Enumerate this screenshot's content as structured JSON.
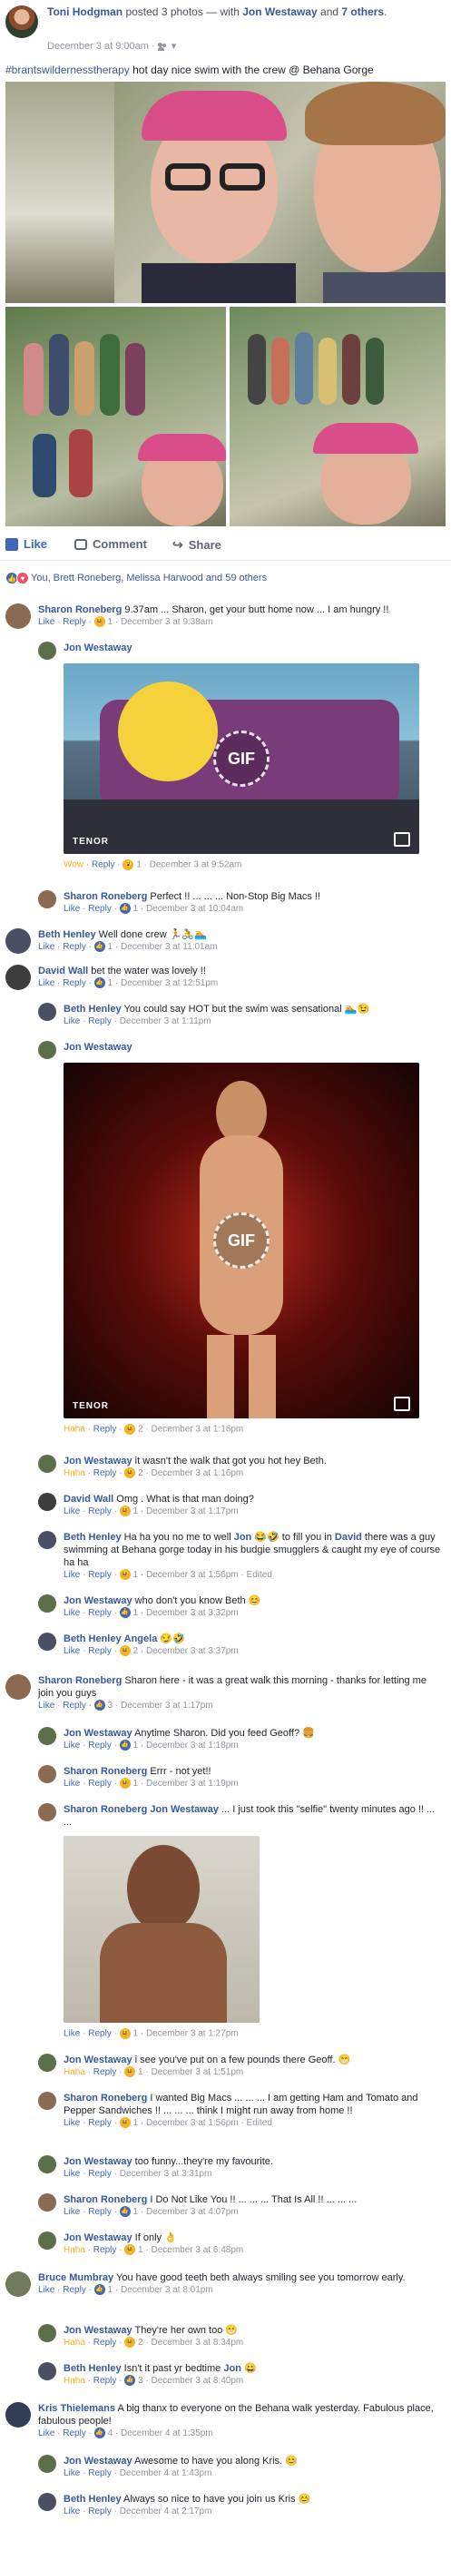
{
  "post": {
    "author": "Toni Hodgman",
    "verb": "posted 3 photos — with",
    "with_name": "Jon Westaway",
    "and": "and",
    "others_link": "7 others",
    "period": ".",
    "time": "December 3 at 9:00am ·",
    "caption_tag": "#brantswildernesstherapy",
    "caption_text": "hot day nice swim with the crew @ Behana Gorge"
  },
  "actions": {
    "like": "Like",
    "comment": "Comment",
    "share": "Share"
  },
  "reactions_summary": "You, Brett Roneberg, Melissa Harwood and 59 others",
  "comments": [
    {
      "name": "Sharon Roneberg",
      "text": "9.37am ... Sharon, get your butt home now ... I am hungry !!",
      "like": "Like",
      "reply": "Reply",
      "count": "1",
      "time": "December 3 at 9:38am"
    },
    {
      "name": "Jon Westaway",
      "text": "",
      "reaction": "Wow",
      "reply": "Reply",
      "count": "1",
      "time": "December 3 at 9:52am"
    },
    {
      "name": "Sharon Roneberg",
      "text": "Perfect !! ... ... ... Non-Stop Big Macs !!",
      "like": "Like",
      "reply": "Reply",
      "count": "1",
      "time": "December 3 at 10:04am"
    },
    {
      "name": "Beth Henley",
      "text": "Well done crew 🏃🚴🏊",
      "like": "Like",
      "reply": "Reply",
      "count": "1",
      "time": "December 3 at 11:01am"
    },
    {
      "name": "David Wall",
      "text": "bet the water was lovely !!",
      "like": "Like",
      "reply": "Reply",
      "count": "1",
      "time": "December 3 at 12:51pm"
    },
    {
      "name": "Beth Henley",
      "text": "You could say HOT but the swim was sensational 🏊😉",
      "like": "Like",
      "reply": "Reply",
      "time": "December 3 at 1:11pm"
    },
    {
      "name": "Jon Westaway",
      "text": "",
      "reaction": "Haha",
      "reply": "Reply",
      "count": "2",
      "time": "December 3 at 1:16pm"
    },
    {
      "name": "Jon Westaway",
      "text": "it wasn't the walk that got you hot hey Beth.",
      "reaction": "Haha",
      "reply": "Reply",
      "count": "2",
      "time": "December 3 at 1:16pm"
    },
    {
      "name": "David Wall",
      "text": "Omg . What is that man doing?",
      "like": "Like",
      "reply": "Reply",
      "count": "1",
      "time": "December 3 at 1:17pm"
    },
    {
      "name": "Beth Henley",
      "text_a": "Ha ha you no me to well",
      "link_a": "Jon",
      "text_b": "😂🤣 to fill you in",
      "link_b": "David",
      "text_c": "there was a guy swimming at Behana gorge today in his budgie smugglers & caught my eye of course ha ha",
      "like": "Like",
      "reply": "Reply",
      "count": "1",
      "time": "December 3 at 1:56pm · Edited"
    },
    {
      "name": "Jon Westaway",
      "text": "who don't you know Beth 😊",
      "like": "Like",
      "reply": "Reply",
      "count": "1",
      "time": "December 3 at 3:32pm"
    },
    {
      "name": "Beth Henley",
      "link": "Angela",
      "text": "😏🤣",
      "like": "Like",
      "reply": "Reply",
      "count": "2",
      "time": "December 3 at 3:37pm"
    },
    {
      "name": "Sharon Roneberg",
      "text": "Sharon here - it was a great walk this morning - thanks for letting me join you guys",
      "like": "Like",
      "reply": "Reply",
      "count": "3",
      "time": "December 3 at 1:17pm"
    },
    {
      "name": "Jon Westaway",
      "text": "Anytime Sharon. Did you feed Geoff? 🍔",
      "like": "Like",
      "reply": "Reply",
      "count": "1",
      "time": "December 3 at 1:18pm"
    },
    {
      "name": "Sharon Roneberg",
      "text": "Errr - not yet!!",
      "like": "Like",
      "reply": "Reply",
      "count": "1",
      "time": "December 3 at 1:19pm"
    },
    {
      "name": "Sharon Roneberg",
      "link": "Jon Westaway",
      "text": "... I just took this \"selfie\" twenty minutes ago !! ... ...",
      "like": "Like",
      "reply": "Reply",
      "count": "1",
      "time": "December 3 at 1:27pm"
    },
    {
      "name": "Jon Westaway",
      "text": "i see you've put on a few pounds there Geoff. 😁",
      "reaction": "Haha",
      "reply": "Reply",
      "count": "1",
      "time": "December 3 at 1:51pm"
    },
    {
      "name": "Sharon Roneberg",
      "text": "I wanted Big Macs ... ... ... I am getting Ham and Tomato and Pepper Sandwiches !! ... ... ... think I might run away from home !!",
      "like": "Like",
      "reply": "Reply",
      "count": "1",
      "time": "December 3 at 1:56pm · Edited"
    },
    {
      "name": "Jon Westaway",
      "text": "too funny...they're my favourite.",
      "like": "Like",
      "reply": "Reply",
      "time": "December 3 at 3:31pm"
    },
    {
      "name": "Sharon Roneberg",
      "text": "I Do Not Like You !! ... ... ... That Is All !! ... ... ...",
      "like": "Like",
      "reply": "Reply",
      "count": "1",
      "time": "December 3 at 4:07pm"
    },
    {
      "name": "Jon Westaway",
      "text": "If only 👌",
      "reaction": "Haha",
      "reply": "Reply",
      "count": "1",
      "time": "December 3 at 6:48pm"
    },
    {
      "name": "Bruce Mumbray",
      "text": "You have good teeth beth always smiling see you tomorrow early.",
      "like": "Like",
      "reply": "Reply",
      "count": "1",
      "time": "December 3 at 8:01pm"
    },
    {
      "name": "Jon Westaway",
      "text": "They're her own too 😁",
      "reaction": "Haha",
      "reply": "Reply",
      "count": "2",
      "time": "December 3 at 8:34pm"
    },
    {
      "name": "Beth Henley",
      "text": "Isn't it past yr bedtime",
      "link": "Jon",
      "emoji": "😀",
      "reaction": "Haha",
      "reply": "Reply",
      "count": "3",
      "time": "December 3 at 8:40pm"
    },
    {
      "name": "Kris Thielemans",
      "text": "A big thanx to everyone on the Behana walk yesterday. Fabulous place, fabulous people!",
      "like": "Like",
      "reply": "Reply",
      "count": "4",
      "time": "December 4 at 1:35pm"
    },
    {
      "name": "Jon Westaway",
      "text": "Awesome to have you along Kris. 😊",
      "like": "Like",
      "reply": "Reply",
      "time": "December 4 at 1:43pm"
    },
    {
      "name": "Beth Henley",
      "text": "Always so nice to have you join us Kris 😊",
      "like": "Like",
      "reply": "Reply",
      "time": "December 4 at 2:17pm"
    }
  ],
  "gif": {
    "badge": "GIF",
    "brand": "TENOR"
  },
  "colors": {
    "link": "#365899",
    "meta": "#90949c",
    "action": "#4267b2",
    "haha": "#f7b125"
  }
}
